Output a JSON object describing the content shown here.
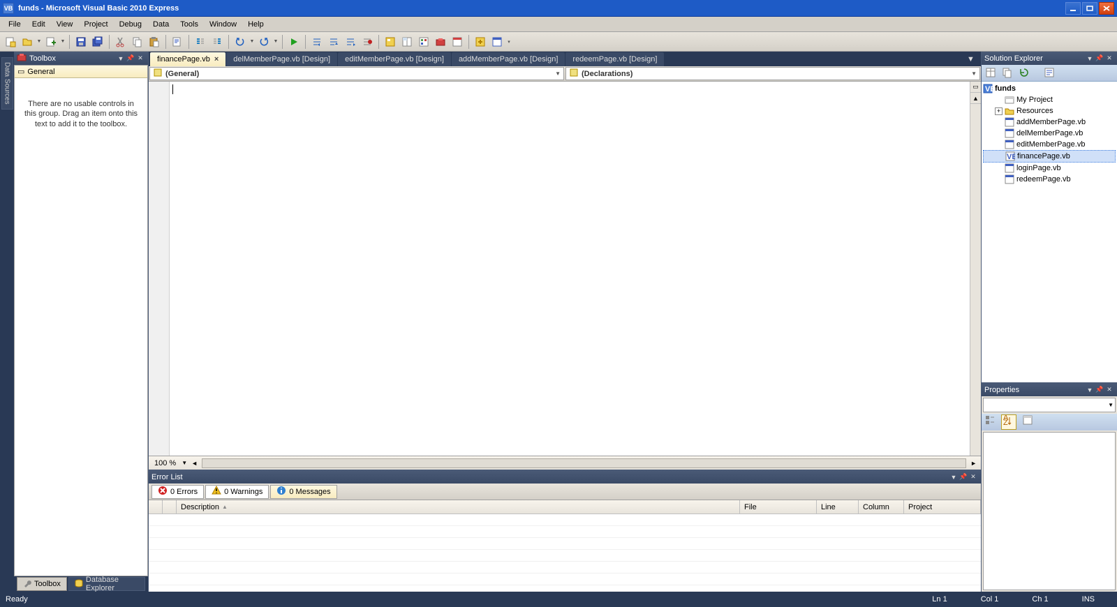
{
  "titlebar": {
    "title": "funds - Microsoft Visual Basic 2010 Express"
  },
  "menu": {
    "items": [
      "File",
      "Edit",
      "View",
      "Project",
      "Debug",
      "Data",
      "Tools",
      "Window",
      "Help"
    ]
  },
  "side_tabs": {
    "data_sources": "Data Sources"
  },
  "toolbox": {
    "title": "Toolbox",
    "group": "General",
    "empty_msg": "There are no usable controls in this group. Drag an item onto this text to add it to the toolbox."
  },
  "editor": {
    "tabs": [
      {
        "label": "financePage.vb",
        "active": true,
        "closable": true
      },
      {
        "label": "delMemberPage.vb [Design]",
        "active": false,
        "closable": false
      },
      {
        "label": "editMemberPage.vb [Design]",
        "active": false,
        "closable": false
      },
      {
        "label": "addMemberPage.vb [Design]",
        "active": false,
        "closable": false
      },
      {
        "label": "redeemPage.vb [Design]",
        "active": false,
        "closable": false
      }
    ],
    "dropdown_left": "(General)",
    "dropdown_right": "(Declarations)",
    "zoom": "100 %"
  },
  "errorlist": {
    "title": "Error List",
    "tabs": {
      "errors": "0 Errors",
      "warnings": "0 Warnings",
      "messages": "0 Messages"
    },
    "columns": [
      "",
      "",
      "Description",
      "File",
      "Line",
      "Column",
      "Project"
    ]
  },
  "bottom_dock": {
    "toolbox": "Toolbox",
    "db_explorer": "Database Explorer"
  },
  "solution_explorer": {
    "title": "Solution Explorer",
    "root": "funds",
    "nodes": [
      {
        "label": "My Project",
        "indent": 1,
        "icon": "proj",
        "exp": null
      },
      {
        "label": "Resources",
        "indent": 1,
        "icon": "folder",
        "exp": "+"
      },
      {
        "label": "addMemberPage.vb",
        "indent": 1,
        "icon": "form",
        "exp": null
      },
      {
        "label": "delMemberPage.vb",
        "indent": 1,
        "icon": "form",
        "exp": null
      },
      {
        "label": "editMemberPage.vb",
        "indent": 1,
        "icon": "form",
        "exp": null
      },
      {
        "label": "financePage.vb",
        "indent": 1,
        "icon": "vb",
        "exp": null,
        "selected": true
      },
      {
        "label": "loginPage.vb",
        "indent": 1,
        "icon": "form",
        "exp": null
      },
      {
        "label": "redeemPage.vb",
        "indent": 1,
        "icon": "form",
        "exp": null
      }
    ]
  },
  "properties": {
    "title": "Properties"
  },
  "statusbar": {
    "ready": "Ready",
    "line": "Ln 1",
    "col": "Col 1",
    "ch": "Ch 1",
    "ins": "INS"
  }
}
